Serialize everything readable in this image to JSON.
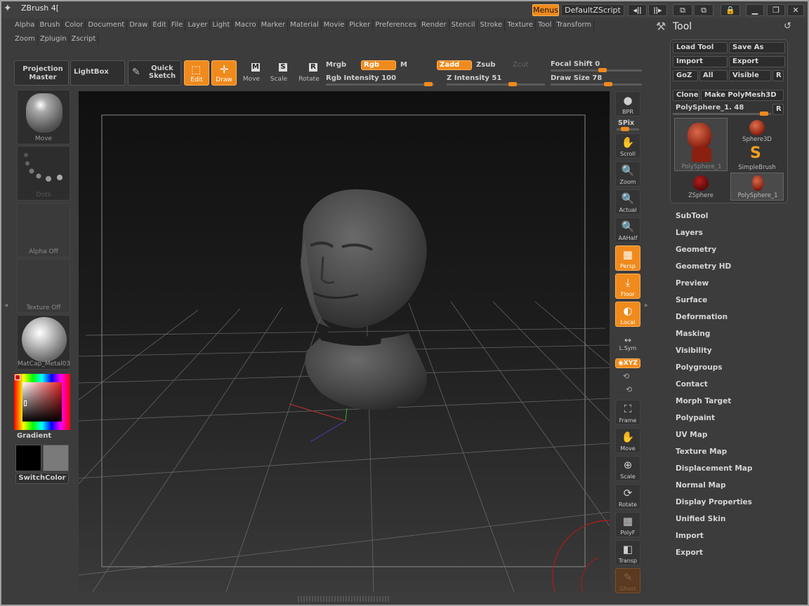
{
  "window": {
    "title": "ZBrush 4[",
    "menus_btn": "Menus",
    "script_name": "DefaultZScript"
  },
  "menubar": {
    "row1": [
      "Alpha",
      "Brush",
      "Color",
      "Document",
      "Draw",
      "Edit",
      "File",
      "Layer",
      "Light",
      "Macro",
      "Marker",
      "Material",
      "Movie",
      "Picker",
      "Preferences",
      "Render",
      "Stencil",
      "Stroke",
      "Texture",
      "Tool",
      "Transform"
    ],
    "row2": [
      "Zoom",
      "Zplugin",
      "Zscript"
    ]
  },
  "shelf": {
    "projection_master": "Projection Master",
    "lightbox": "LightBox",
    "quick_sketch": "Quick Sketch",
    "edit": "Edit",
    "draw": "Draw",
    "move": "Move",
    "scale": "Scale",
    "rotate": "Rotate",
    "move_key": "M",
    "scale_key": "S",
    "rotate_key": "R",
    "mrgb": "Mrgb",
    "rgb": "Rgb",
    "m": "M",
    "zadd": "Zadd",
    "zsub": "Zsub",
    "zcut": "Zcut",
    "rgb_intensity_label": "Rgb Intensity",
    "rgb_intensity": "100",
    "z_intensity_label": "Z Intensity",
    "z_intensity": "51",
    "focal_shift_label": "Focal Shift",
    "focal_shift": "0",
    "draw_size_label": "Draw Size",
    "draw_size": "78"
  },
  "left_panel": {
    "brush": "Move",
    "stroke": "Dots",
    "alpha": "Alpha  Off",
    "texture": "Texture  Off",
    "material": "MatCap_Metal03",
    "gradient": "Gradient",
    "switch_color": "SwitchColor"
  },
  "right_toolbar": {
    "bpr": "BPR",
    "spix": "SPix",
    "scroll": "Scroll",
    "zoom": "Zoom",
    "actual": "Actual",
    "aahalf": "AAHalf",
    "persp": "Persp",
    "floor": "Floor",
    "local": "Local",
    "lsym": "L.Sym",
    "xyz": "◉XYZ",
    "frame": "Frame",
    "move": "Move",
    "scale": "Scale",
    "rotate": "Rotate",
    "polyf": "PolyF",
    "transp": "Transp",
    "ghost": "Ghost"
  },
  "tool_palette": {
    "title": "Tool",
    "load_tool": "Load Tool",
    "save_as": "Save As",
    "import": "Import",
    "export": "Export",
    "goz": "GoZ",
    "all": "All",
    "visible": "Visible",
    "r": "R",
    "clone": "Clone",
    "make_polymesh": "Make PolyMesh3D",
    "current_tool": "PolySphere_1. 48",
    "thumbs": [
      "PolySphere_1",
      "Sphere3D",
      "SimpleBrush",
      "ZSphere",
      "PolySphere_1"
    ],
    "subpalettes": [
      "SubTool",
      "Layers",
      "Geometry",
      "Geometry HD",
      "Preview",
      "Surface",
      "Deformation",
      "Masking",
      "Visibility",
      "Polygroups",
      "Contact",
      "Morph Target",
      "Polypaint",
      "UV Map",
      "Texture Map",
      "Displacement Map",
      "Normal Map",
      "Display Properties",
      "Unified Skin",
      "Import",
      "Export"
    ]
  },
  "colors": {
    "accent": "#f08a1c",
    "background": "#3c3c3c",
    "panel": "#2f2f2f"
  }
}
